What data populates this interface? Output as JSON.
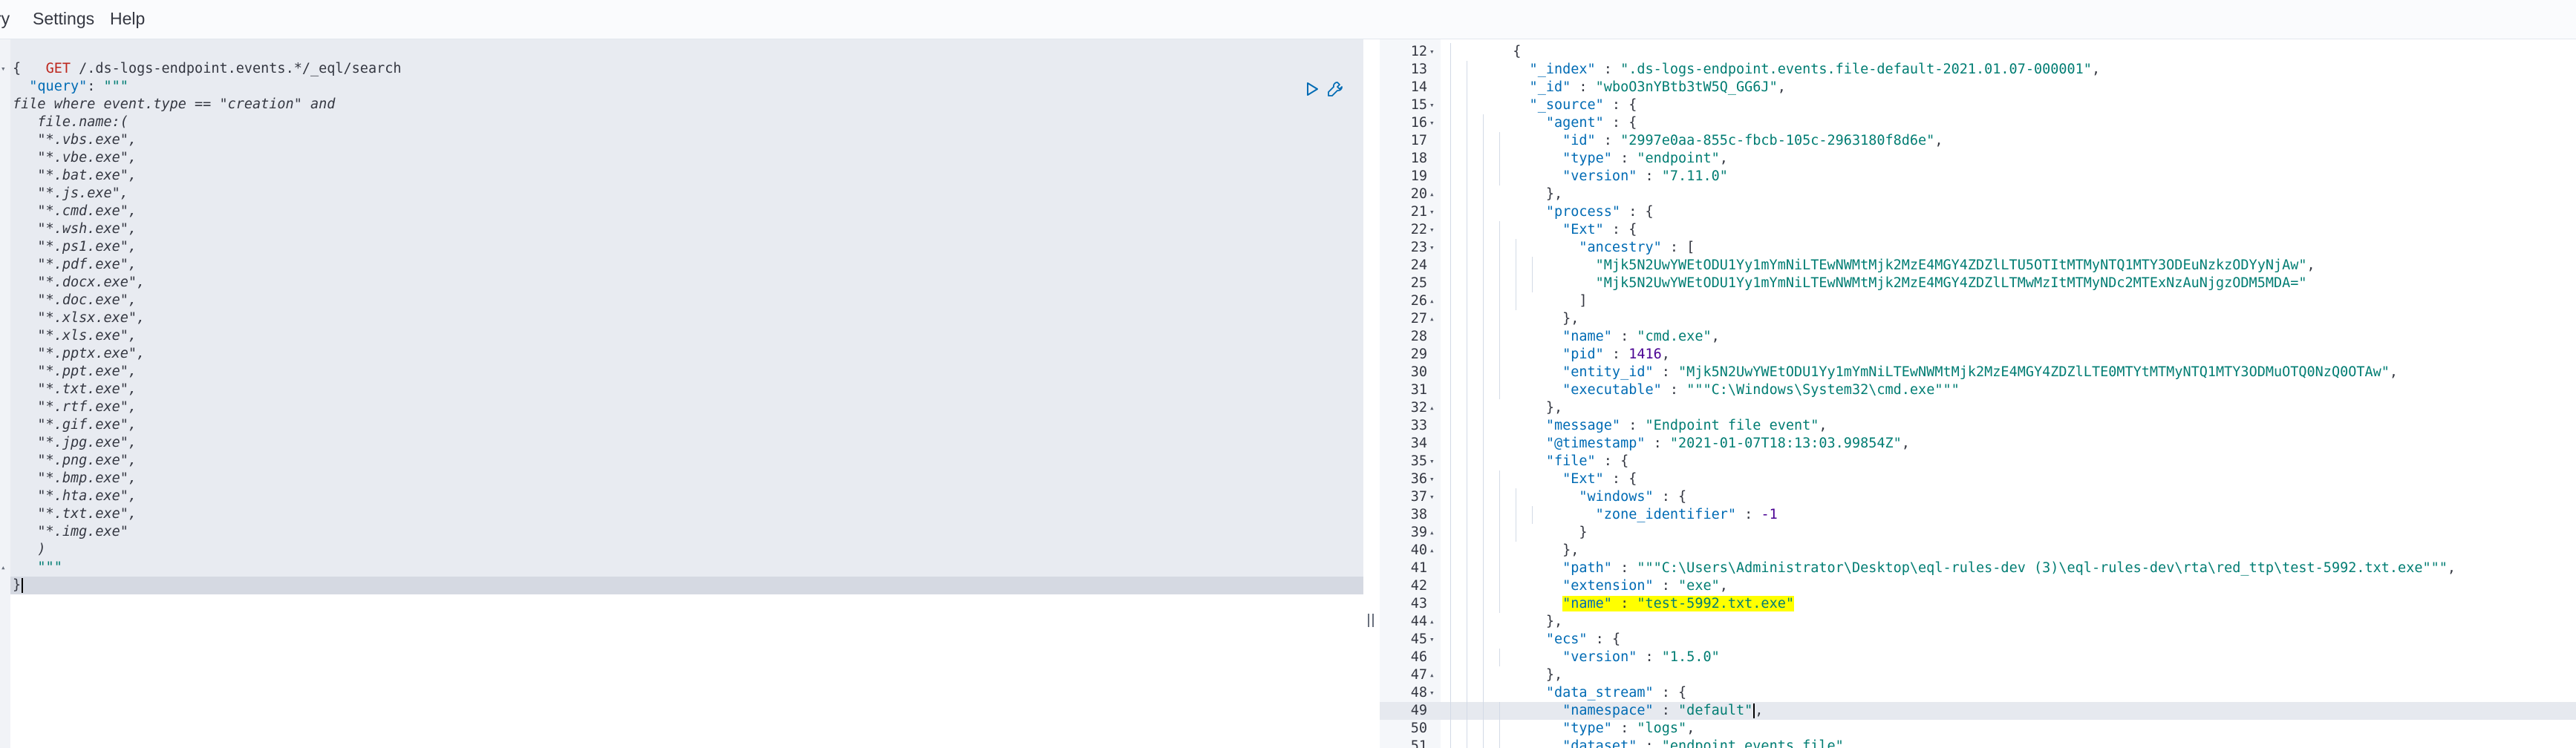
{
  "menu": [
    "ry",
    "Settings",
    "Help"
  ],
  "request": {
    "method": "GET",
    "path": " /.ds-logs-endpoint.events.*/_eql/search",
    "lines": [
      [
        [
          "p",
          "{"
        ]
      ],
      [
        [
          "k",
          "  \"query\""
        ],
        [
          "p",
          ": "
        ],
        [
          "s",
          "\"\"\""
        ]
      ],
      [
        [
          "e",
          "file where event.type == \"creation\" and"
        ]
      ],
      [
        [
          "e",
          "   file.name:("
        ]
      ],
      [
        [
          "e",
          "   \"*.vbs.exe\","
        ]
      ],
      [
        [
          "e",
          "   \"*.vbe.exe\","
        ]
      ],
      [
        [
          "e",
          "   \"*.bat.exe\","
        ]
      ],
      [
        [
          "e",
          "   \"*.js.exe\","
        ]
      ],
      [
        [
          "e",
          "   \"*.cmd.exe\","
        ]
      ],
      [
        [
          "e",
          "   \"*.wsh.exe\","
        ]
      ],
      [
        [
          "e",
          "   \"*.ps1.exe\","
        ]
      ],
      [
        [
          "e",
          "   \"*.pdf.exe\","
        ]
      ],
      [
        [
          "e",
          "   \"*.docx.exe\","
        ]
      ],
      [
        [
          "e",
          "   \"*.doc.exe\","
        ]
      ],
      [
        [
          "e",
          "   \"*.xlsx.exe\","
        ]
      ],
      [
        [
          "e",
          "   \"*.xls.exe\","
        ]
      ],
      [
        [
          "e",
          "   \"*.pptx.exe\","
        ]
      ],
      [
        [
          "e",
          "   \"*.ppt.exe\","
        ]
      ],
      [
        [
          "e",
          "   \"*.txt.exe\","
        ]
      ],
      [
        [
          "e",
          "   \"*.rtf.exe\","
        ]
      ],
      [
        [
          "e",
          "   \"*.gif.exe\","
        ]
      ],
      [
        [
          "e",
          "   \"*.jpg.exe\","
        ]
      ],
      [
        [
          "e",
          "   \"*.png.exe\","
        ]
      ],
      [
        [
          "e",
          "   \"*.bmp.exe\","
        ]
      ],
      [
        [
          "e",
          "   \"*.hta.exe\","
        ]
      ],
      [
        [
          "e",
          "   \"*.txt.exe\","
        ]
      ],
      [
        [
          "e",
          "   \"*.img.exe\""
        ]
      ],
      [
        [
          "e",
          "   )"
        ]
      ],
      [
        [
          "s",
          "   \"\"\""
        ]
      ],
      [
        [
          "p",
          "}"
        ]
      ]
    ],
    "fold_lines": [
      0,
      28
    ]
  },
  "response": {
    "active_line": 49,
    "lines": [
      {
        "n": "12",
        "fold": "down",
        "d": 1,
        "t": [
          [
            "p",
            "  {"
          ]
        ]
      },
      {
        "n": "13",
        "fold": "",
        "d": 2,
        "t": [
          [
            "k",
            "    \"_index\""
          ],
          [
            "p",
            " : "
          ],
          [
            "s",
            "\".ds-logs-endpoint.events.file-default-2021.01.07-000001\""
          ],
          [
            "p",
            ","
          ]
        ]
      },
      {
        "n": "14",
        "fold": "",
        "d": 2,
        "t": [
          [
            "k",
            "    \"_id\""
          ],
          [
            "p",
            " : "
          ],
          [
            "s",
            "\"wboO3nYBtb3tW5Q_GG6J\""
          ],
          [
            "p",
            ","
          ]
        ]
      },
      {
        "n": "15",
        "fold": "down",
        "d": 2,
        "t": [
          [
            "k",
            "    \"_source\""
          ],
          [
            "p",
            " : {"
          ]
        ]
      },
      {
        "n": "16",
        "fold": "down",
        "d": 3,
        "t": [
          [
            "k",
            "      \"agent\""
          ],
          [
            "p",
            " : {"
          ]
        ]
      },
      {
        "n": "17",
        "fold": "",
        "d": 4,
        "t": [
          [
            "k",
            "        \"id\""
          ],
          [
            "p",
            " : "
          ],
          [
            "s",
            "\"2997e0aa-855c-fbcb-105c-2963180f8d6e\""
          ],
          [
            "p",
            ","
          ]
        ]
      },
      {
        "n": "18",
        "fold": "",
        "d": 4,
        "t": [
          [
            "k",
            "        \"type\""
          ],
          [
            "p",
            " : "
          ],
          [
            "s",
            "\"endpoint\""
          ],
          [
            "p",
            ","
          ]
        ]
      },
      {
        "n": "19",
        "fold": "",
        "d": 4,
        "t": [
          [
            "k",
            "        \"version\""
          ],
          [
            "p",
            " : "
          ],
          [
            "s",
            "\"7.11.0\""
          ]
        ]
      },
      {
        "n": "20",
        "fold": "up",
        "d": 3,
        "t": [
          [
            "p",
            "      },"
          ]
        ]
      },
      {
        "n": "21",
        "fold": "down",
        "d": 3,
        "t": [
          [
            "k",
            "      \"process\""
          ],
          [
            "p",
            " : {"
          ]
        ]
      },
      {
        "n": "22",
        "fold": "down",
        "d": 4,
        "t": [
          [
            "k",
            "        \"Ext\""
          ],
          [
            "p",
            " : {"
          ]
        ]
      },
      {
        "n": "23",
        "fold": "down",
        "d": 5,
        "t": [
          [
            "k",
            "          \"ancestry\""
          ],
          [
            "p",
            " : ["
          ]
        ]
      },
      {
        "n": "24",
        "fold": "",
        "d": 6,
        "t": [
          [
            "s",
            "            \"Mjk5N2UwYWEtODU1Yy1mYmNiLTEwNWMtMjk2MzE4MGY4ZDZlLTU5OTItMTMyNTQ1MTY3ODEuNzkzODYyNjAw\""
          ],
          [
            "p",
            ","
          ]
        ]
      },
      {
        "n": "25",
        "fold": "",
        "d": 6,
        "t": [
          [
            "s",
            "            \"Mjk5N2UwYWEtODU1Yy1mYmNiLTEwNWMtMjk2MzE4MGY4ZDZlLTMwMzItMTMyNDc2MTExNzAuNjgzODM5MDA=\""
          ]
        ]
      },
      {
        "n": "26",
        "fold": "up",
        "d": 5,
        "t": [
          [
            "p",
            "          ]"
          ]
        ]
      },
      {
        "n": "27",
        "fold": "up",
        "d": 4,
        "t": [
          [
            "p",
            "        },"
          ]
        ]
      },
      {
        "n": "28",
        "fold": "",
        "d": 4,
        "t": [
          [
            "k",
            "        \"name\""
          ],
          [
            "p",
            " : "
          ],
          [
            "s",
            "\"cmd.exe\""
          ],
          [
            "p",
            ","
          ]
        ]
      },
      {
        "n": "29",
        "fold": "",
        "d": 4,
        "t": [
          [
            "k",
            "        \"pid\""
          ],
          [
            "p",
            " : "
          ],
          [
            "n",
            "1416"
          ],
          [
            "p",
            ","
          ]
        ]
      },
      {
        "n": "30",
        "fold": "",
        "d": 4,
        "t": [
          [
            "k",
            "        \"entity_id\""
          ],
          [
            "p",
            " : "
          ],
          [
            "s",
            "\"Mjk5N2UwYWEtODU1Yy1mYmNiLTEwNWMtMjk2MzE4MGY4ZDZlLTE0MTYtMTMyNTQ1MTY3ODMuOTQ0NzQ0OTAw\""
          ],
          [
            "p",
            ","
          ]
        ]
      },
      {
        "n": "31",
        "fold": "",
        "d": 4,
        "t": [
          [
            "k",
            "        \"executable\""
          ],
          [
            "p",
            " : "
          ],
          [
            "s",
            "\"\"\"C:\\Windows\\System32\\cmd.exe\"\"\""
          ]
        ]
      },
      {
        "n": "32",
        "fold": "up",
        "d": 3,
        "t": [
          [
            "p",
            "      },"
          ]
        ]
      },
      {
        "n": "33",
        "fold": "",
        "d": 3,
        "t": [
          [
            "k",
            "      \"message\""
          ],
          [
            "p",
            " : "
          ],
          [
            "s",
            "\"Endpoint file event\""
          ],
          [
            "p",
            ","
          ]
        ]
      },
      {
        "n": "34",
        "fold": "",
        "d": 3,
        "t": [
          [
            "k",
            "      \"@timestamp\""
          ],
          [
            "p",
            " : "
          ],
          [
            "s",
            "\"2021-01-07T18:13:03.99854Z\""
          ],
          [
            "p",
            ","
          ]
        ]
      },
      {
        "n": "35",
        "fold": "down",
        "d": 3,
        "t": [
          [
            "k",
            "      \"file\""
          ],
          [
            "p",
            " : {"
          ]
        ]
      },
      {
        "n": "36",
        "fold": "down",
        "d": 4,
        "t": [
          [
            "k",
            "        \"Ext\""
          ],
          [
            "p",
            " : {"
          ]
        ]
      },
      {
        "n": "37",
        "fold": "down",
        "d": 5,
        "t": [
          [
            "k",
            "          \"windows\""
          ],
          [
            "p",
            " : {"
          ]
        ]
      },
      {
        "n": "38",
        "fold": "",
        "d": 6,
        "t": [
          [
            "k",
            "            \"zone_identifier\""
          ],
          [
            "p",
            " : "
          ],
          [
            "n",
            "-1"
          ]
        ]
      },
      {
        "n": "39",
        "fold": "up",
        "d": 5,
        "t": [
          [
            "p",
            "          }"
          ]
        ]
      },
      {
        "n": "40",
        "fold": "up",
        "d": 4,
        "t": [
          [
            "p",
            "        },"
          ]
        ]
      },
      {
        "n": "41",
        "fold": "",
        "d": 4,
        "t": [
          [
            "k",
            "        \"path\""
          ],
          [
            "p",
            " : "
          ],
          [
            "s",
            "\"\"\"C:\\Users\\Administrator\\Desktop\\eql-rules-dev (3)\\eql-rules-dev\\rta\\red_ttp\\test-5992.txt.exe\"\"\""
          ],
          [
            "p",
            ","
          ]
        ]
      },
      {
        "n": "42",
        "fold": "",
        "d": 4,
        "t": [
          [
            "k",
            "        \"extension\""
          ],
          [
            "p",
            " : "
          ],
          [
            "s",
            "\"exe\""
          ],
          [
            "p",
            ","
          ]
        ]
      },
      {
        "n": "43",
        "fold": "",
        "d": 4,
        "t": [
          [
            "p",
            "        "
          ],
          [
            "hk",
            "\"name\""
          ],
          [
            "hp",
            " : "
          ],
          [
            "hs",
            "\"test-5992.txt.exe\""
          ]
        ]
      },
      {
        "n": "44",
        "fold": "up",
        "d": 3,
        "t": [
          [
            "p",
            "      },"
          ]
        ]
      },
      {
        "n": "45",
        "fold": "down",
        "d": 3,
        "t": [
          [
            "k",
            "      \"ecs\""
          ],
          [
            "p",
            " : {"
          ]
        ]
      },
      {
        "n": "46",
        "fold": "",
        "d": 4,
        "t": [
          [
            "k",
            "        \"version\""
          ],
          [
            "p",
            " : "
          ],
          [
            "s",
            "\"1.5.0\""
          ]
        ]
      },
      {
        "n": "47",
        "fold": "up",
        "d": 3,
        "t": [
          [
            "p",
            "      },"
          ]
        ]
      },
      {
        "n": "48",
        "fold": "down",
        "d": 3,
        "t": [
          [
            "k",
            "      \"data_stream\""
          ],
          [
            "p",
            " : {"
          ]
        ]
      },
      {
        "n": "49",
        "fold": "",
        "d": 4,
        "t": [
          [
            "k",
            "        \"namespace\""
          ],
          [
            "p",
            " : "
          ],
          [
            "s",
            "\"default\""
          ],
          [
            "c",
            ""
          ],
          [
            "p",
            ","
          ]
        ]
      },
      {
        "n": "50",
        "fold": "",
        "d": 4,
        "t": [
          [
            "k",
            "        \"type\""
          ],
          [
            "p",
            " : "
          ],
          [
            "s",
            "\"logs\""
          ],
          [
            "p",
            ","
          ]
        ]
      },
      {
        "n": "51",
        "fold": "",
        "d": 4,
        "t": [
          [
            "k",
            "        \"dataset\""
          ],
          [
            "p",
            " : "
          ],
          [
            "s",
            "\"endpoint.events.file\""
          ]
        ]
      }
    ]
  },
  "icons": {
    "run": "play-triangle-icon",
    "wrench": "wrench-icon",
    "splitter": "drag-handle-icon"
  },
  "colors": {
    "method": "#bd271e",
    "key": "#006bb4",
    "string": "#017d73",
    "number": "#490092",
    "highlight": "#ffff00",
    "request_bg": "#e8ebf1"
  }
}
